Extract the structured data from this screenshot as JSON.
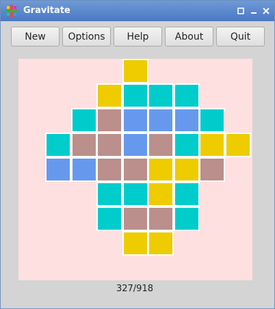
{
  "window": {
    "title": "Gravitate"
  },
  "toolbar": {
    "buttons": [
      {
        "id": "new",
        "label": "New"
      },
      {
        "id": "options",
        "label": "Options"
      },
      {
        "id": "help",
        "label": "Help"
      },
      {
        "id": "about",
        "label": "About"
      },
      {
        "id": "quit",
        "label": "Quit"
      }
    ]
  },
  "status": {
    "score": "327/918"
  },
  "colors": {
    "yellow": "#eecc00",
    "cyan": "#00cccc",
    "blue": "#6699ee",
    "mauve": "#bb8f8b",
    "board": "#ffe0e0"
  },
  "board": {
    "rows": [
      [
        "",
        "",
        "",
        "",
        "Y",
        "",
        "",
        "",
        ""
      ],
      [
        "",
        "",
        "",
        "Y",
        "C",
        "C",
        "C",
        "",
        ""
      ],
      [
        "",
        "",
        "C",
        "M",
        "B",
        "B",
        "B",
        "C",
        ""
      ],
      [
        "",
        "C",
        "M",
        "M",
        "B",
        "M",
        "C",
        "Y",
        "Y"
      ],
      [
        "",
        "B",
        "B",
        "M",
        "M",
        "Y",
        "Y",
        "M",
        ""
      ],
      [
        "",
        "",
        "",
        "C",
        "C",
        "Y",
        "C",
        "",
        ""
      ],
      [
        "",
        "",
        "",
        "C",
        "M",
        "M",
        "C",
        "",
        ""
      ],
      [
        "",
        "",
        "",
        "",
        "Y",
        "Y",
        "",
        "",
        ""
      ]
    ]
  }
}
